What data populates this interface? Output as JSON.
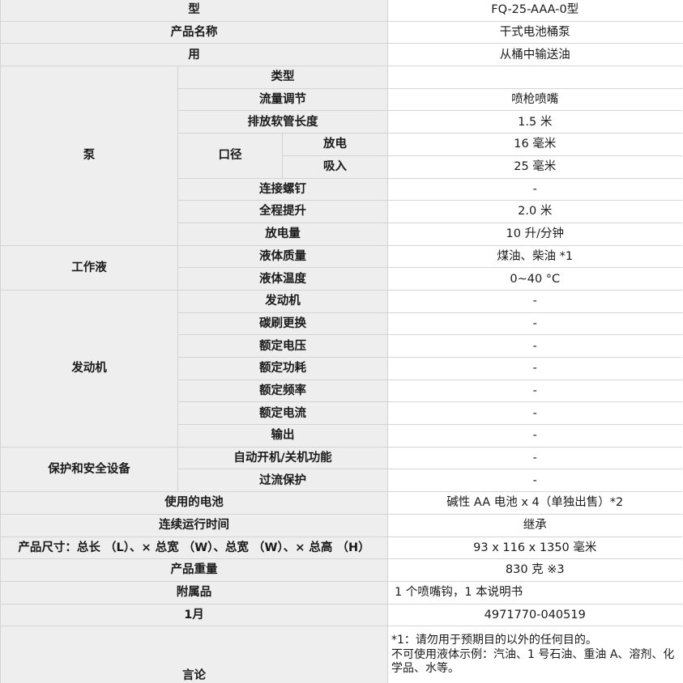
{
  "rows": {
    "model": {
      "label": "型",
      "value": "FQ-25-AAA-0型"
    },
    "product_name": {
      "label": "产品名称",
      "value": "干式电池桶泵"
    },
    "usage": {
      "label": "用",
      "value": "从桶中输送油"
    }
  },
  "pump": {
    "group": "泵",
    "type": {
      "label": "类型",
      "value": ""
    },
    "flow_adjust": {
      "label": "流量调节",
      "value": "喷枪喷嘴"
    },
    "hose_length": {
      "label": "排放软管长度",
      "value": "1.5 米"
    },
    "diameter": {
      "label": "口径",
      "discharge": {
        "label": "放电",
        "value": "16 毫米"
      },
      "suction": {
        "label": "吸入",
        "value": "25 毫米"
      }
    },
    "screw": {
      "label": "连接螺钉",
      "value": "-"
    },
    "lift": {
      "label": "全程提升",
      "value": "2.0 米"
    },
    "discharge_volume": {
      "label": "放电量",
      "value": "10 升/分钟"
    }
  },
  "fluid": {
    "group": "工作液",
    "quality": {
      "label": "液体质量",
      "value": "煤油、柴油 *1"
    },
    "temperature": {
      "label": "液体温度",
      "value": "0~40 °C"
    }
  },
  "motor": {
    "group": "发动机",
    "items": [
      {
        "label": "发动机",
        "value": "-"
      },
      {
        "label": "碳刷更换",
        "value": "-"
      },
      {
        "label": "额定电压",
        "value": "-"
      },
      {
        "label": "额定功耗",
        "value": "-"
      },
      {
        "label": "额定频率",
        "value": "-"
      },
      {
        "label": "额定电流",
        "value": "-"
      },
      {
        "label": "输出",
        "value": "-"
      }
    ]
  },
  "safety": {
    "group": "保护和安全设备",
    "auto_switch": {
      "label": "自动开机/关机功能",
      "value": "-"
    },
    "overcurrent": {
      "label": "过流保护",
      "value": "-"
    }
  },
  "tail": {
    "battery": {
      "label": "使用的电池",
      "value": "碱性 AA 电池 x 4（单独出售）*2"
    },
    "runtime": {
      "label": "连续运行时间",
      "value": "继承"
    },
    "dimensions": {
      "label": "产品尺寸：总长 （L）、× 总宽 （W）、总宽 （W）、× 总高 （H）",
      "value": "93 x 116 x 1350 毫米"
    },
    "weight": {
      "label": "产品重量",
      "value": "830 克 ※3"
    },
    "accessories": {
      "label": "附属品",
      "value": "1 个喷嘴钩，1 本说明书"
    },
    "jan": {
      "label": "1月",
      "value": "4971770-040519"
    },
    "remarks": {
      "label": "言论",
      "lines": [
        "*1：请勿用于预期目的以外的任何目的。",
        "不可使用液体示例：汽油、1 号石油、重油 A、溶剂、化学品、水等。"
      ]
    }
  }
}
